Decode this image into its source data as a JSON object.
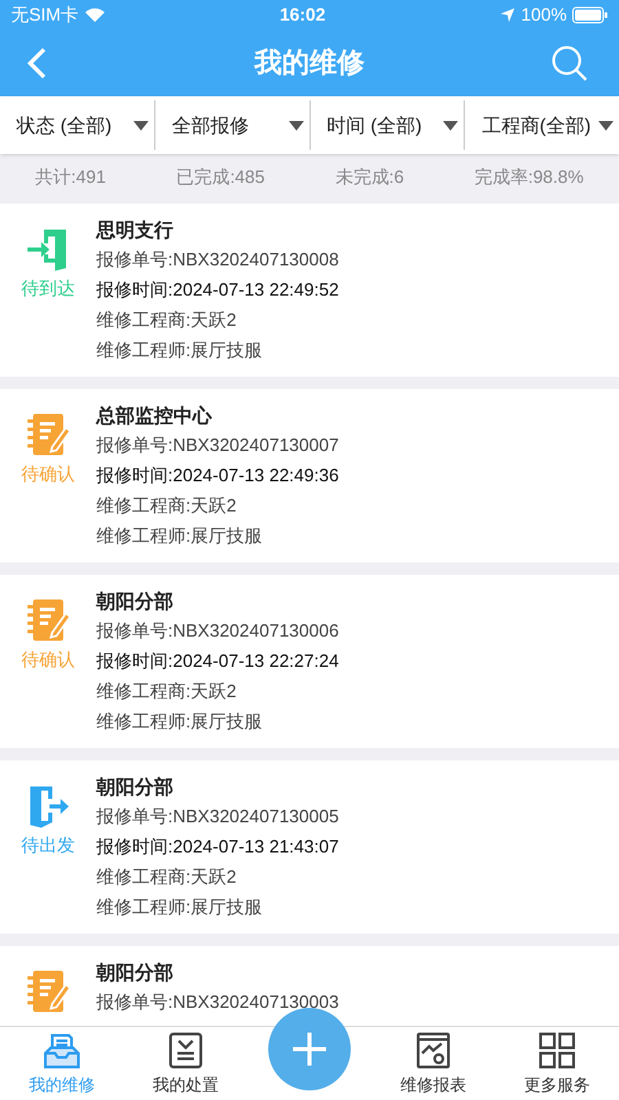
{
  "status_bar": {
    "carrier": "无SIM卡",
    "time": "16:02",
    "battery": "100%"
  },
  "header": {
    "title": "我的维修"
  },
  "filters": [
    {
      "label": "状态 (全部)"
    },
    {
      "label": "全部报修"
    },
    {
      "label": "时间 (全部)"
    },
    {
      "label": "工程商(全部)"
    }
  ],
  "stats": [
    "共计:491",
    "已完成:485",
    "未完成:6",
    "完成率:98.8%"
  ],
  "orders": [
    {
      "kind": "arrive",
      "status": "待到达",
      "name": "思明支行",
      "order_no": "报修单号:NBX3202407130008",
      "time": "报修时间:2024-07-13 22:49:52",
      "vendor": "维修工程商:天跃2",
      "engineer": "维修工程师:展厅技服"
    },
    {
      "kind": "confirm",
      "status": "待确认",
      "name": "总部监控中心",
      "order_no": "报修单号:NBX3202407130007",
      "time": "报修时间:2024-07-13 22:49:36",
      "vendor": "维修工程商:天跃2",
      "engineer": "维修工程师:展厅技服"
    },
    {
      "kind": "confirm",
      "status": "待确认",
      "name": "朝阳分部",
      "order_no": "报修单号:NBX3202407130006",
      "time": "报修时间:2024-07-13 22:27:24",
      "vendor": "维修工程商:天跃2",
      "engineer": "维修工程师:展厅技服"
    },
    {
      "kind": "depart",
      "status": "待出发",
      "name": "朝阳分部",
      "order_no": "报修单号:NBX3202407130005",
      "time": "报修时间:2024-07-13 21:43:07",
      "vendor": "维修工程商:天跃2",
      "engineer": "维修工程师:展厅技服"
    },
    {
      "kind": "confirm",
      "name": "朝阳分部",
      "order_no": "报修单号:NBX3202407130003"
    }
  ],
  "tab_bar": [
    {
      "kind": "inbox",
      "label": "我的维修",
      "selected": true
    },
    {
      "kind": "checklist",
      "label": "我的处置",
      "selected": false
    },
    {
      "kind": "add"
    },
    {
      "kind": "report",
      "label": "维修报表",
      "selected": false
    },
    {
      "kind": "grid",
      "label": "更多服务",
      "selected": false
    }
  ]
}
